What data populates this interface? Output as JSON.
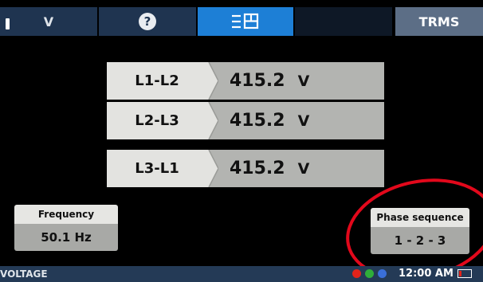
{
  "tabs": {
    "voltage_label": "V",
    "help_symbol": "?",
    "phase_symbol": "≡H",
    "mode_label": "TRMS"
  },
  "measurements": [
    {
      "label": "L1-L2",
      "value": "415.2",
      "unit": "V"
    },
    {
      "label": "L2-L3",
      "value": "415.2",
      "unit": "V"
    },
    {
      "label": "L3-L1",
      "value": "415.2",
      "unit": "V"
    }
  ],
  "frequency": {
    "title": "Frequency",
    "value": "50.1 Hz"
  },
  "phase_sequence": {
    "title": "Phase sequence",
    "value": "1 - 2 - 3"
  },
  "status_bar": {
    "mode": "VOLTAGE",
    "time": "12:00 AM",
    "indicator_colors": [
      "#e2231a",
      "#2fae3a",
      "#3a6fd8"
    ]
  },
  "colors": {
    "tab_active": "#1d7fd6",
    "annotation": "#e2081b"
  },
  "icons": [
    "help-icon",
    "three-phase-icon",
    "battery-icon"
  ]
}
